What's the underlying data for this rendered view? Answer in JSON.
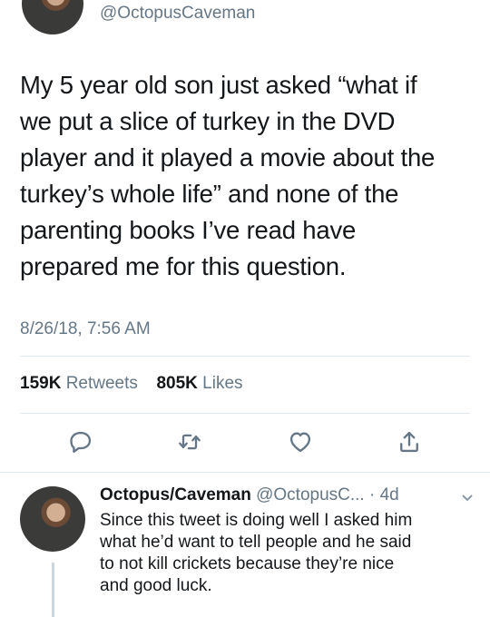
{
  "tweet": {
    "handle": "@OctopusCaveman",
    "text": "My 5 year old son just asked “what if\nwe put a slice of turkey in the DVD\nplayer and it played a movie about the\nturkey’s whole life” and none of the\nparenting books I’ve read have\nprepared me for this question.",
    "timestamp": "8/26/18, 7:56 AM",
    "retweets_count": "159K",
    "retweets_label": "Retweets",
    "likes_count": "805K",
    "likes_label": "Likes"
  },
  "actions": [
    {
      "icon": "reply-icon"
    },
    {
      "icon": "retweet-icon"
    },
    {
      "icon": "like-icon"
    },
    {
      "icon": "share-icon"
    }
  ],
  "reply": {
    "name": "Octopus/Caveman",
    "handle": "@OctopusC...",
    "time": "· 4d",
    "text": "Since this tweet is doing well I asked him\nwhat he’d want to tell people and he said\nto not kill crickets because they’re nice\nand good luck."
  },
  "colors": {
    "text": "#14171a",
    "secondary": "#657786",
    "divider": "#e1e8ed"
  }
}
